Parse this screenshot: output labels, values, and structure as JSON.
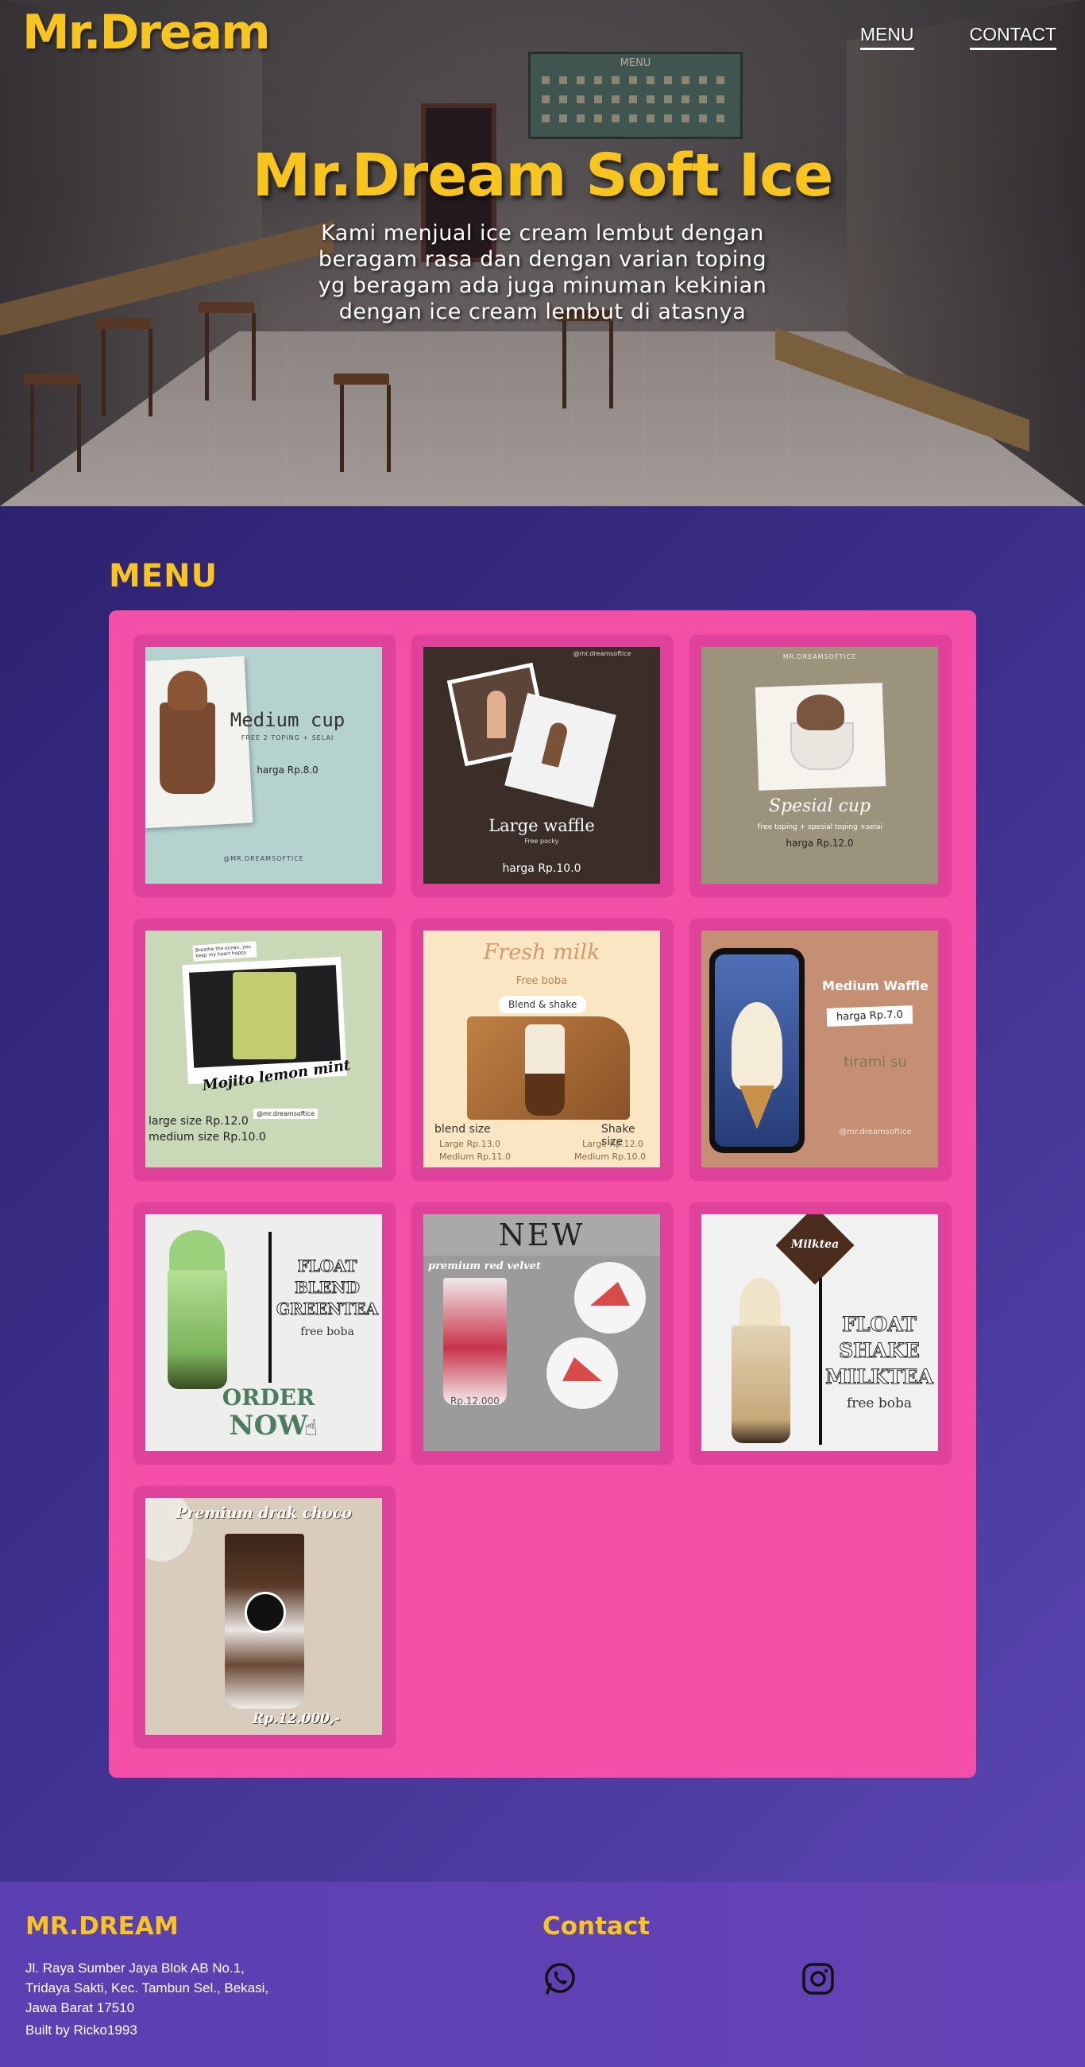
{
  "nav": {
    "logo": "Mr.Dream",
    "links": [
      "MENU",
      "CONTACT"
    ]
  },
  "hero": {
    "title": "Mr.Dream Soft Ice",
    "description_lines": [
      "Kami menjual ice cream lembut dengan",
      "beragam rasa dan dengan varian toping",
      "yg beragam ada juga minuman kekinian",
      "dengan ice cream lembut di atasnya"
    ],
    "board_label": "MENU"
  },
  "menu": {
    "heading": "MENU",
    "items": [
      {
        "name": "Medium cup",
        "lines": [
          "FREE 2 TOPING + SELAI",
          "harga Rp.8.0",
          "@MR.DREAMSOFTICE"
        ]
      },
      {
        "name": "Large waffle",
        "lines": [
          "@mr.dreamsoftice",
          "Free pocky",
          "harga Rp.10.0"
        ]
      },
      {
        "name": "Spesial cup",
        "lines": [
          "MR.DREAMSOFTICE",
          "Free toping + spesial toping +selai",
          "harga Rp.12.0"
        ]
      },
      {
        "name": "Mojito lemon mint",
        "lines": [
          "Breathe the ocean, you keep my heart happy",
          "large size Rp.12.0",
          "medium size Rp.10.0",
          "@mr.dreamsoftice"
        ]
      },
      {
        "name": "Fresh milk",
        "lines": [
          "Free boba",
          "Blend & shake",
          "blend size",
          "Shake size",
          "Large Rp.13.0",
          "Medium Rp.11.0",
          "Large Rp.12.0",
          "Medium Rp.10.0"
        ]
      },
      {
        "name": "Medium Waffle",
        "lines": [
          "harga Rp.7.0",
          "tirami su",
          "@mr.dreamsoftice"
        ]
      },
      {
        "name": "FLOAT BLEND GREENTEA",
        "lines": [
          "free boba",
          "ORDER",
          "NOW"
        ]
      },
      {
        "name": "NEW",
        "lines": [
          "premium red velvet",
          "Rp.12.000"
        ]
      },
      {
        "name": "FLOAT SHAKE MILKTEA",
        "lines": [
          "Milktea",
          "free boba"
        ]
      },
      {
        "name": "Premium drak choco",
        "lines": [
          "Rp.12.000,-"
        ]
      }
    ]
  },
  "footer": {
    "brand": "MR.DREAM",
    "address_lines": [
      "Jl. Raya Sumber Jaya Blok AB No.1,",
      "Tridaya Sakti, Kec. Tambun Sel., Bekasi,",
      "Jawa Barat 17510"
    ],
    "built_by": "Built by Ricko1993",
    "contact_heading": "Contact",
    "icons": [
      "whatsapp-icon",
      "instagram-icon"
    ]
  },
  "colors": {
    "accent": "#f7c51e",
    "panel": "#f34fa6",
    "card": "#e0419a",
    "section_bg": "#3c2f8a",
    "footer_bg": "#5f41b4"
  }
}
